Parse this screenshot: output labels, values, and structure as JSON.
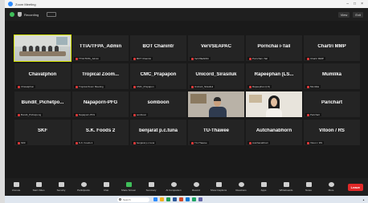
{
  "window": {
    "title": "Zoom Meeting"
  },
  "topbar": {
    "recording": "Recording",
    "view_label": "View",
    "exit_label": "Exit"
  },
  "tiles": [
    {
      "name": "",
      "label": ""
    },
    {
      "name": "TTIA/TFPA_Admin",
      "label": "TTIA/TFPA_Admin"
    },
    {
      "name": "BOT Chanintr",
      "label": "BOT Chanintr"
    },
    {
      "name": "VerVSEAPAC",
      "label": "VerVSEAPAC"
    },
    {
      "name": "Pornchai i-Tail",
      "label": "Pornchai i-Tail"
    },
    {
      "name": "Chartri MMP",
      "label": "Chartri MMP"
    },
    {
      "name": "Chavatphon",
      "label": "Chavatphon"
    },
    {
      "name": "Tropical Zoom...",
      "label": "Tropical Zoom Meeting"
    },
    {
      "name": "CMC_Prapapon",
      "label": "CMC_Prapapon"
    },
    {
      "name": "Unicord_Sirasiluk",
      "label": "Unicord_Sirasiluk"
    },
    {
      "name": "Rapeephan (LS...",
      "label": "Rapeephan (LS)"
    },
    {
      "name": "Mumlika",
      "label": "Mumlika"
    },
    {
      "name": "Bundit_Pichetpo...",
      "label": "Bundit_Pichetpong"
    },
    {
      "name": "Napaporn-PFG",
      "label": "Napaporn-PFG"
    },
    {
      "name": "somboon",
      "label": "somboon"
    },
    {
      "name": "",
      "label": ""
    },
    {
      "name": "",
      "label": ""
    },
    {
      "name": "Parichart",
      "label": "Parichart"
    },
    {
      "name": "SKF",
      "label": "SKF"
    },
    {
      "name": "S.K. Foods 2",
      "label": "S.K. Foods 2"
    },
    {
      "name": "benjarat p.c.tuna",
      "label": "benjarat p.c.tuna"
    },
    {
      "name": "TU-Thawee",
      "label": "TU-Thawee"
    },
    {
      "name": "Autchanabhorn",
      "label": "Autchanabhorn"
    },
    {
      "name": "Vitoon / RS",
      "label": "Vitoon / RS"
    }
  ],
  "toolbar": {
    "items": [
      {
        "label": "Unmute"
      },
      {
        "label": "Start Video"
      },
      {
        "label": "Security"
      },
      {
        "label": "Participants"
      },
      {
        "label": "Chat"
      },
      {
        "label": "Share Screen"
      },
      {
        "label": "Summary"
      },
      {
        "label": "AI Companion"
      },
      {
        "label": "Record"
      },
      {
        "label": "Show Captions"
      },
      {
        "label": "Reactions"
      },
      {
        "label": "Apps"
      },
      {
        "label": "Whiteboards"
      },
      {
        "label": "Notes"
      },
      {
        "label": "More"
      }
    ],
    "end_label": "Leave"
  },
  "taskbar": {
    "search_placeholder": "Search"
  }
}
